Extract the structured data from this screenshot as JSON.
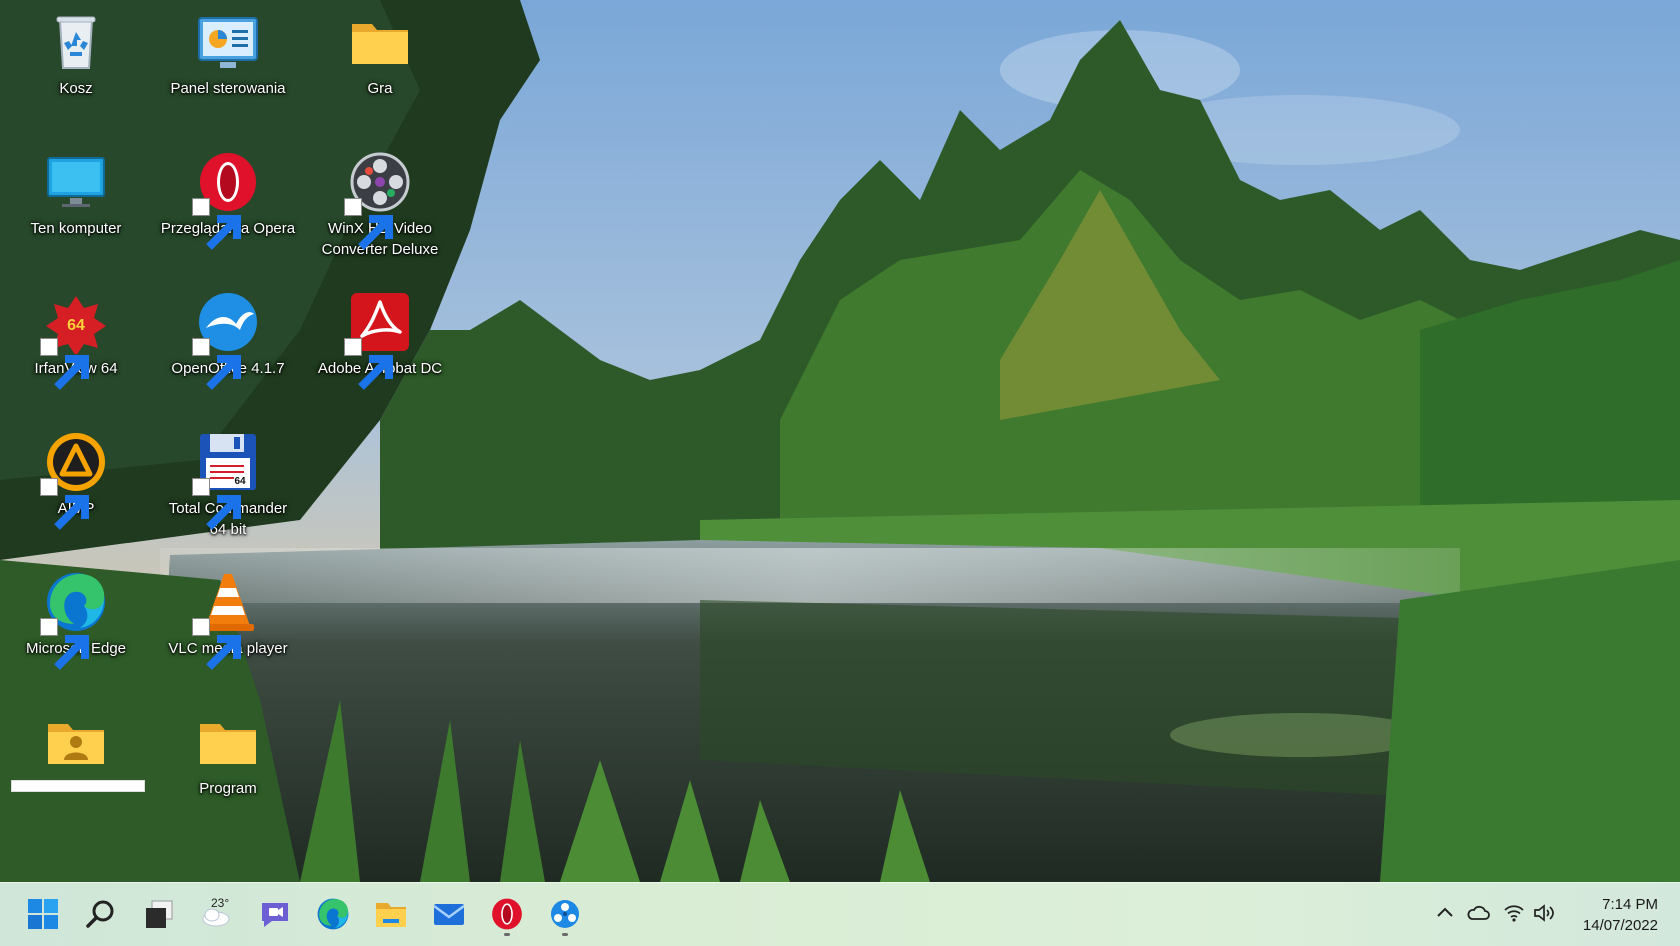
{
  "desktop": {
    "icons": [
      {
        "label": "Kosz",
        "icon": "recycle-bin-icon"
      },
      {
        "label": "Panel sterowania",
        "icon": "control-panel-icon"
      },
      {
        "label": "Gra",
        "icon": "folder-icon"
      },
      {
        "label": "Ten komputer",
        "icon": "monitor-icon"
      },
      {
        "label": "Przeglądarka Opera",
        "icon": "opera-icon"
      },
      {
        "label": "WinX HD Video Converter Deluxe",
        "icon": "film-reel-icon"
      },
      {
        "label": "IrfanView 64",
        "icon": "irfanview-icon"
      },
      {
        "label": "OpenOffice 4.1.7",
        "icon": "openoffice-icon"
      },
      {
        "label": "Adobe Acrobat DC",
        "icon": "acrobat-icon"
      },
      {
        "label": "AIMP",
        "icon": "aimp-icon"
      },
      {
        "label": "Total Commander 64 bit",
        "icon": "floppy-disk-icon"
      },
      {
        "label": "Microsoft Edge",
        "icon": "edge-icon"
      },
      {
        "label": "VLC media player",
        "icon": "vlc-cone-icon"
      },
      {
        "label": "",
        "icon": "user-folder-icon"
      },
      {
        "label": "Program",
        "icon": "folder-icon"
      }
    ]
  },
  "taskbar": {
    "weather_temp": "23°",
    "apps": [
      {
        "name": "start",
        "icon": "windows-logo-icon"
      },
      {
        "name": "search",
        "icon": "search-icon"
      },
      {
        "name": "task-view",
        "icon": "task-view-icon"
      },
      {
        "name": "widgets",
        "icon": "weather-cloud-icon"
      },
      {
        "name": "chat",
        "icon": "teams-chat-icon"
      },
      {
        "name": "edge",
        "icon": "edge-icon"
      },
      {
        "name": "file-explorer",
        "icon": "file-explorer-icon"
      },
      {
        "name": "mail",
        "icon": "mail-icon"
      },
      {
        "name": "opera",
        "icon": "opera-icon"
      },
      {
        "name": "control-panel",
        "icon": "control-panel-icon"
      }
    ],
    "tray": {
      "icons": [
        "chevron-up-icon",
        "onedrive-cloud-icon",
        "wifi-icon",
        "speaker-icon"
      ],
      "time": "7:14 PM",
      "date": "14/07/2022"
    }
  },
  "colors": {
    "taskbar_bg": "#d6ead7",
    "accent_windows": "#1e88e5"
  }
}
